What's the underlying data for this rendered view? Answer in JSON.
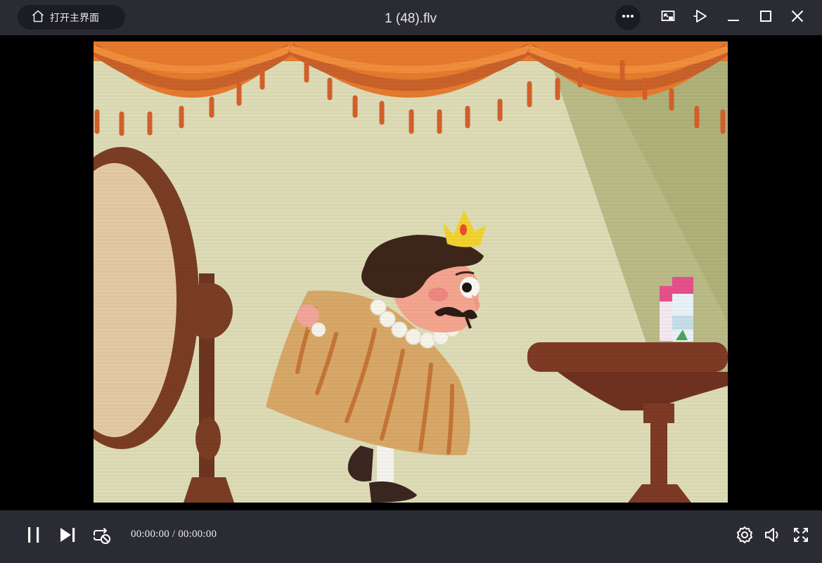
{
  "titlebar": {
    "home_label": "打开主界面",
    "file_title": "1 (48).flv",
    "icons": [
      "home-icon",
      "more-icon",
      "mini-mode-icon",
      "pin-top-icon",
      "minimize-icon",
      "maximize-icon",
      "close-icon"
    ]
  },
  "player": {
    "current_time": "00:00:00",
    "separator": " / ",
    "total_time": "00:00:00",
    "state": "playing"
  },
  "controls": {
    "left_icons": [
      "pause-icon",
      "next-icon",
      "loop-off-icon"
    ],
    "right_icons": [
      "settings-icon",
      "volume-icon",
      "fullscreen-icon"
    ]
  },
  "colors": {
    "bar_background": "#2b2c33",
    "home_button_background": "#1c1d22",
    "text": "#e6e6ea",
    "video_background": "#000000"
  }
}
